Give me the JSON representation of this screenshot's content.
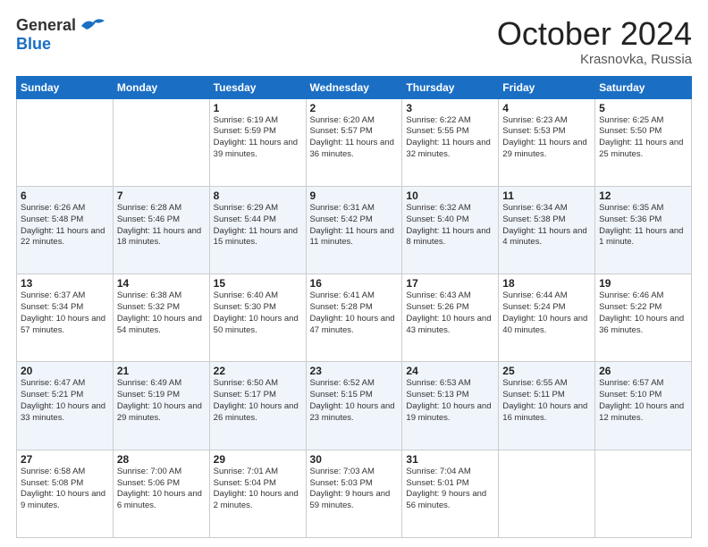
{
  "header": {
    "logo_line1": "General",
    "logo_line2": "Blue",
    "month": "October 2024",
    "location": "Krasnovka, Russia"
  },
  "days_of_week": [
    "Sunday",
    "Monday",
    "Tuesday",
    "Wednesday",
    "Thursday",
    "Friday",
    "Saturday"
  ],
  "weeks": [
    [
      {
        "num": "",
        "info": ""
      },
      {
        "num": "",
        "info": ""
      },
      {
        "num": "1",
        "info": "Sunrise: 6:19 AM\nSunset: 5:59 PM\nDaylight: 11 hours and 39 minutes."
      },
      {
        "num": "2",
        "info": "Sunrise: 6:20 AM\nSunset: 5:57 PM\nDaylight: 11 hours and 36 minutes."
      },
      {
        "num": "3",
        "info": "Sunrise: 6:22 AM\nSunset: 5:55 PM\nDaylight: 11 hours and 32 minutes."
      },
      {
        "num": "4",
        "info": "Sunrise: 6:23 AM\nSunset: 5:53 PM\nDaylight: 11 hours and 29 minutes."
      },
      {
        "num": "5",
        "info": "Sunrise: 6:25 AM\nSunset: 5:50 PM\nDaylight: 11 hours and 25 minutes."
      }
    ],
    [
      {
        "num": "6",
        "info": "Sunrise: 6:26 AM\nSunset: 5:48 PM\nDaylight: 11 hours and 22 minutes."
      },
      {
        "num": "7",
        "info": "Sunrise: 6:28 AM\nSunset: 5:46 PM\nDaylight: 11 hours and 18 minutes."
      },
      {
        "num": "8",
        "info": "Sunrise: 6:29 AM\nSunset: 5:44 PM\nDaylight: 11 hours and 15 minutes."
      },
      {
        "num": "9",
        "info": "Sunrise: 6:31 AM\nSunset: 5:42 PM\nDaylight: 11 hours and 11 minutes."
      },
      {
        "num": "10",
        "info": "Sunrise: 6:32 AM\nSunset: 5:40 PM\nDaylight: 11 hours and 8 minutes."
      },
      {
        "num": "11",
        "info": "Sunrise: 6:34 AM\nSunset: 5:38 PM\nDaylight: 11 hours and 4 minutes."
      },
      {
        "num": "12",
        "info": "Sunrise: 6:35 AM\nSunset: 5:36 PM\nDaylight: 11 hours and 1 minute."
      }
    ],
    [
      {
        "num": "13",
        "info": "Sunrise: 6:37 AM\nSunset: 5:34 PM\nDaylight: 10 hours and 57 minutes."
      },
      {
        "num": "14",
        "info": "Sunrise: 6:38 AM\nSunset: 5:32 PM\nDaylight: 10 hours and 54 minutes."
      },
      {
        "num": "15",
        "info": "Sunrise: 6:40 AM\nSunset: 5:30 PM\nDaylight: 10 hours and 50 minutes."
      },
      {
        "num": "16",
        "info": "Sunrise: 6:41 AM\nSunset: 5:28 PM\nDaylight: 10 hours and 47 minutes."
      },
      {
        "num": "17",
        "info": "Sunrise: 6:43 AM\nSunset: 5:26 PM\nDaylight: 10 hours and 43 minutes."
      },
      {
        "num": "18",
        "info": "Sunrise: 6:44 AM\nSunset: 5:24 PM\nDaylight: 10 hours and 40 minutes."
      },
      {
        "num": "19",
        "info": "Sunrise: 6:46 AM\nSunset: 5:22 PM\nDaylight: 10 hours and 36 minutes."
      }
    ],
    [
      {
        "num": "20",
        "info": "Sunrise: 6:47 AM\nSunset: 5:21 PM\nDaylight: 10 hours and 33 minutes."
      },
      {
        "num": "21",
        "info": "Sunrise: 6:49 AM\nSunset: 5:19 PM\nDaylight: 10 hours and 29 minutes."
      },
      {
        "num": "22",
        "info": "Sunrise: 6:50 AM\nSunset: 5:17 PM\nDaylight: 10 hours and 26 minutes."
      },
      {
        "num": "23",
        "info": "Sunrise: 6:52 AM\nSunset: 5:15 PM\nDaylight: 10 hours and 23 minutes."
      },
      {
        "num": "24",
        "info": "Sunrise: 6:53 AM\nSunset: 5:13 PM\nDaylight: 10 hours and 19 minutes."
      },
      {
        "num": "25",
        "info": "Sunrise: 6:55 AM\nSunset: 5:11 PM\nDaylight: 10 hours and 16 minutes."
      },
      {
        "num": "26",
        "info": "Sunrise: 6:57 AM\nSunset: 5:10 PM\nDaylight: 10 hours and 12 minutes."
      }
    ],
    [
      {
        "num": "27",
        "info": "Sunrise: 6:58 AM\nSunset: 5:08 PM\nDaylight: 10 hours and 9 minutes."
      },
      {
        "num": "28",
        "info": "Sunrise: 7:00 AM\nSunset: 5:06 PM\nDaylight: 10 hours and 6 minutes."
      },
      {
        "num": "29",
        "info": "Sunrise: 7:01 AM\nSunset: 5:04 PM\nDaylight: 10 hours and 2 minutes."
      },
      {
        "num": "30",
        "info": "Sunrise: 7:03 AM\nSunset: 5:03 PM\nDaylight: 9 hours and 59 minutes."
      },
      {
        "num": "31",
        "info": "Sunrise: 7:04 AM\nSunset: 5:01 PM\nDaylight: 9 hours and 56 minutes."
      },
      {
        "num": "",
        "info": ""
      },
      {
        "num": "",
        "info": ""
      }
    ]
  ]
}
